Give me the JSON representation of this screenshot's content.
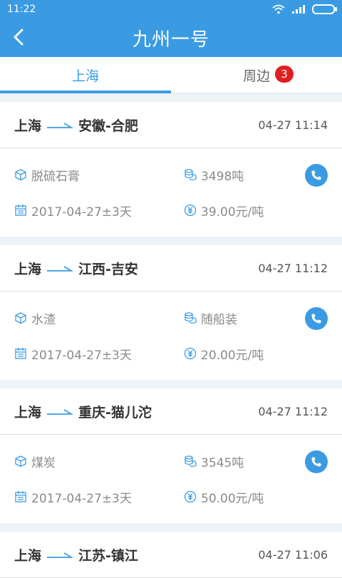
{
  "status_bar": {
    "time": "11:22"
  },
  "header": {
    "title": "九州一号"
  },
  "tabs": [
    {
      "label": "上海",
      "active": true
    },
    {
      "label": "周边",
      "badge": "3"
    }
  ],
  "colors": {
    "accent": "#3a9be3",
    "badge": "#e02020"
  },
  "cards": [
    {
      "origin": "上海",
      "destination": "安徽-合肥",
      "time": "04-27 11:14",
      "cargo": "脱硫石膏",
      "quantity": "3498吨",
      "date": "2017-04-27±3天",
      "price": "39.00元/吨"
    },
    {
      "origin": "上海",
      "destination": "江西-吉安",
      "time": "04-27 11:12",
      "cargo": "水渣",
      "quantity": "随船装",
      "date": "2017-04-27±3天",
      "price": "20.00元/吨"
    },
    {
      "origin": "上海",
      "destination": "重庆-猫儿沱",
      "time": "04-27 11:12",
      "cargo": "煤炭",
      "quantity": "3545吨",
      "date": "2017-04-27±3天",
      "price": "50.00元/吨"
    },
    {
      "origin": "上海",
      "destination": "江苏-镇江",
      "time": "04-27 11:06"
    }
  ]
}
